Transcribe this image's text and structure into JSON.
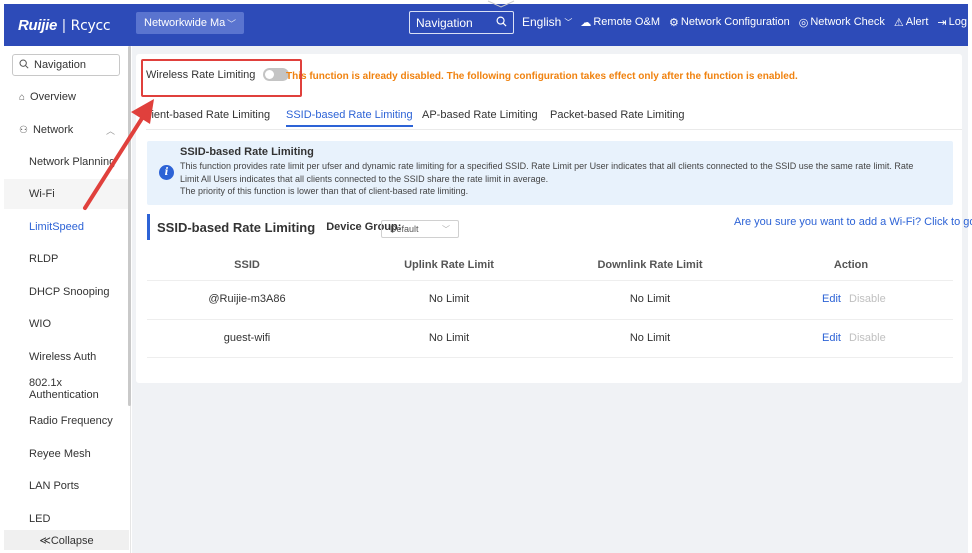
{
  "header": {
    "logo_brand": "Ruijie",
    "logo_sub": "Rcycc",
    "network_select": "Networkwide Ma",
    "nav_search_label": "Navigation",
    "language": "English",
    "items": [
      {
        "label": "Remote O&M",
        "icon": "cloud-icon"
      },
      {
        "label": "Network Configuration",
        "icon": "network-config-icon"
      },
      {
        "label": "Network Check",
        "icon": "network-check-icon"
      },
      {
        "label": "Alert",
        "icon": "alert-icon"
      },
      {
        "label": "Log Out",
        "icon": "logout-icon"
      }
    ],
    "colors": {
      "bar": "#2d4bb8"
    }
  },
  "sidebar": {
    "search_label": "Navigation",
    "items": [
      {
        "label": "Overview",
        "icon": "home-icon"
      },
      {
        "label": "Network",
        "icon": "network-icon"
      },
      {
        "label": "Network Planning"
      },
      {
        "label": "Wi-Fi"
      },
      {
        "label": "LimitSpeed"
      },
      {
        "label": "RLDP"
      },
      {
        "label": "DHCP Snooping"
      },
      {
        "label": "WIO"
      },
      {
        "label": "Wireless Auth"
      },
      {
        "label": "802.1x Authentication"
      },
      {
        "label": "Radio Frequency"
      },
      {
        "label": "Reyee Mesh"
      },
      {
        "label": "LAN Ports"
      },
      {
        "label": "LED"
      }
    ],
    "collapse_label": "≪Collapse"
  },
  "main": {
    "toggle_label": "Wireless Rate Limiting",
    "toggle_state": "off",
    "warning": "This function is already disabled. The following configuration takes effect only after the function is enabled.",
    "tabs": [
      {
        "label": "lient-based Rate Limiting"
      },
      {
        "label": "SSID-based Rate Limiting",
        "active": true
      },
      {
        "label": "AP-based Rate Limiting"
      },
      {
        "label": "Packet-based Rate Limiting"
      }
    ],
    "info": {
      "title": "SSID-based Rate Limiting",
      "line1": "This function provides rate limit per ufser and dynamic rate limiting for a specified SSID. Rate Limit per User indicates that all clients connected to the SSID use the same rate limit. Rate",
      "line2": "Limit All Users indicates that all clients connected to the SSID share the rate limit in average.",
      "line3": "The priority of this function is lower than that of client-based rate limiting."
    },
    "section": {
      "title": "SSID-based Rate Limiting",
      "device_group_label": "Device Group:",
      "device_group_value": "Default",
      "add_wifi_link": "Are you sure you want to add a Wi-Fi? Click to go."
    },
    "table": {
      "headers": [
        "SSID",
        "Uplink Rate Limit",
        "Downlink Rate Limit",
        "Action"
      ],
      "rows": [
        {
          "ssid": "@Ruijie-m3A86",
          "uplink": "No Limit",
          "downlink": "No Limit",
          "edit": "Edit",
          "disable": "Disable"
        },
        {
          "ssid": "guest-wifi",
          "uplink": "No Limit",
          "downlink": "No Limit",
          "edit": "Edit",
          "disable": "Disable"
        }
      ]
    }
  }
}
